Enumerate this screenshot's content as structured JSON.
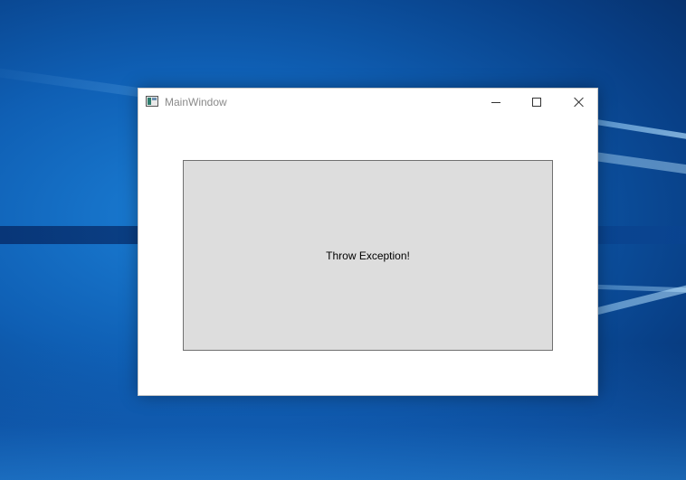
{
  "window": {
    "title": "MainWindow"
  },
  "titlebar": {
    "icons": {
      "app": "window-app-icon",
      "minimize": "minimize-icon",
      "maximize": "maximize-icon",
      "close": "close-icon"
    }
  },
  "main": {
    "button_label": "Throw Exception!"
  },
  "colors": {
    "button_face": "#dddddd",
    "button_border": "#707070",
    "title_text": "#8a8a8a",
    "desktop_blue": "#0f5fb4"
  }
}
